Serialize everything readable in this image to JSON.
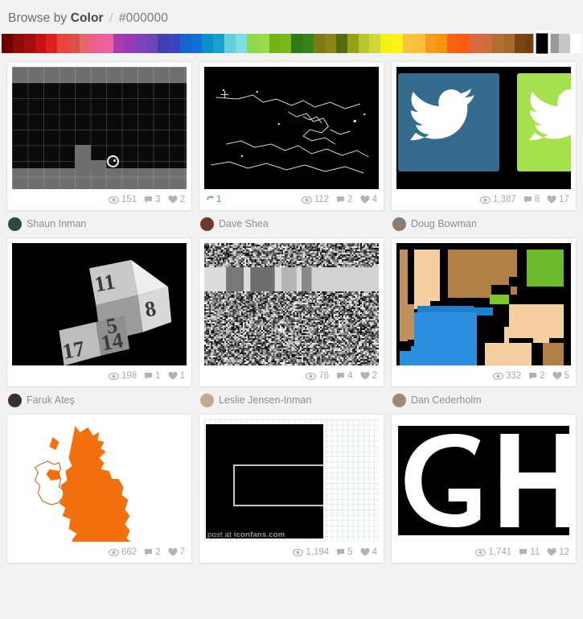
{
  "header": {
    "browse_by": "Browse by",
    "facet": "Color",
    "separator": "/",
    "hex": "#000000"
  },
  "palette": {
    "swatches": [
      "#6d0000",
      "#8c0b0b",
      "#a30f0f",
      "#c51111",
      "#e01f1f",
      "#e8453d",
      "#dd4f48",
      "#e36a6a",
      "#ef5f93",
      "#f0609a",
      "#a73cb0",
      "#9b38b5",
      "#7a45b8",
      "#6c45b8",
      "#3f3fae",
      "#3a46c0",
      "#1266cc",
      "#0a72d8",
      "#0f8fc8",
      "#17a2cc",
      "#62cfdb",
      "#7ddce6",
      "#8ed84f",
      "#9ada4c",
      "#73b313",
      "#7ab81a",
      "#2f7a17",
      "#35851b",
      "#7d7b14",
      "#8a8516",
      "#566b0c",
      "#94a315",
      "#b8c72a",
      "#cdd93b",
      "#f2f214",
      "#fbf31a",
      "#f7c53a",
      "#f9bf3b",
      "#f89a1c",
      "#f9930f",
      "#f96114",
      "#fb5c10",
      "#d96a40",
      "#cf6b3f",
      "#b07030",
      "#a9682c",
      "#7a4510",
      "#70400e"
    ],
    "selected": {
      "color": "#000000",
      "index": 48
    },
    "trailing": [
      "#9a9a9a",
      "#c7c7c7",
      "#ffffff"
    ]
  },
  "icons": {
    "views": "eye-icon",
    "comments": "comment-icon",
    "likes": "heart-icon",
    "rebound": "rebound-icon"
  },
  "shots": [
    {
      "id": "shot-1",
      "art": "grid-game",
      "views": "151",
      "comments": "3",
      "likes": "2",
      "rebound": null,
      "author": "Shaun Inman",
      "avatar_color": "#2f4a3a"
    },
    {
      "id": "shot-2",
      "art": "coastline",
      "views": "112",
      "comments": "2",
      "likes": "4",
      "rebound": "1",
      "author": "Dave Shea",
      "avatar_color": "#6b3a22"
    },
    {
      "id": "shot-3",
      "art": "twitter-tiles",
      "views": "1,387",
      "comments": "8",
      "likes": "17",
      "rebound": null,
      "author": "Doug Bowman",
      "avatar_color": "#8a7c6e"
    },
    {
      "id": "shot-4",
      "art": "dice-type",
      "views": "198",
      "comments": "1",
      "likes": "1",
      "rebound": null,
      "author": "Faruk Ateş",
      "avatar_color": "#3a3028"
    },
    {
      "id": "shot-5",
      "art": "static-noise",
      "views": "76",
      "comments": "4",
      "likes": "2",
      "rebound": null,
      "author": "Leslie Jensen-Inman",
      "avatar_color": "#c4a98c"
    },
    {
      "id": "shot-6",
      "art": "pixel-art",
      "views": "332",
      "comments": "2",
      "likes": "5",
      "rebound": null,
      "author": "Dan Cederholm",
      "avatar_color": "#9b8b76"
    },
    {
      "id": "shot-7",
      "art": "uk-map",
      "views": "662",
      "comments": "2",
      "likes": "7",
      "rebound": null,
      "author": null,
      "avatar_color": null
    },
    {
      "id": "shot-8",
      "art": "blackboard-grid",
      "views": "1,194",
      "comments": "5",
      "likes": "4",
      "rebound": null,
      "author": null,
      "avatar_color": null,
      "watermark_prefix": "post at ",
      "watermark_site": "iconfans.com"
    },
    {
      "id": "shot-9",
      "art": "big-letters",
      "views": "1,741",
      "comments": "11",
      "likes": "12",
      "rebound": null,
      "author": null,
      "avatar_color": null
    }
  ]
}
